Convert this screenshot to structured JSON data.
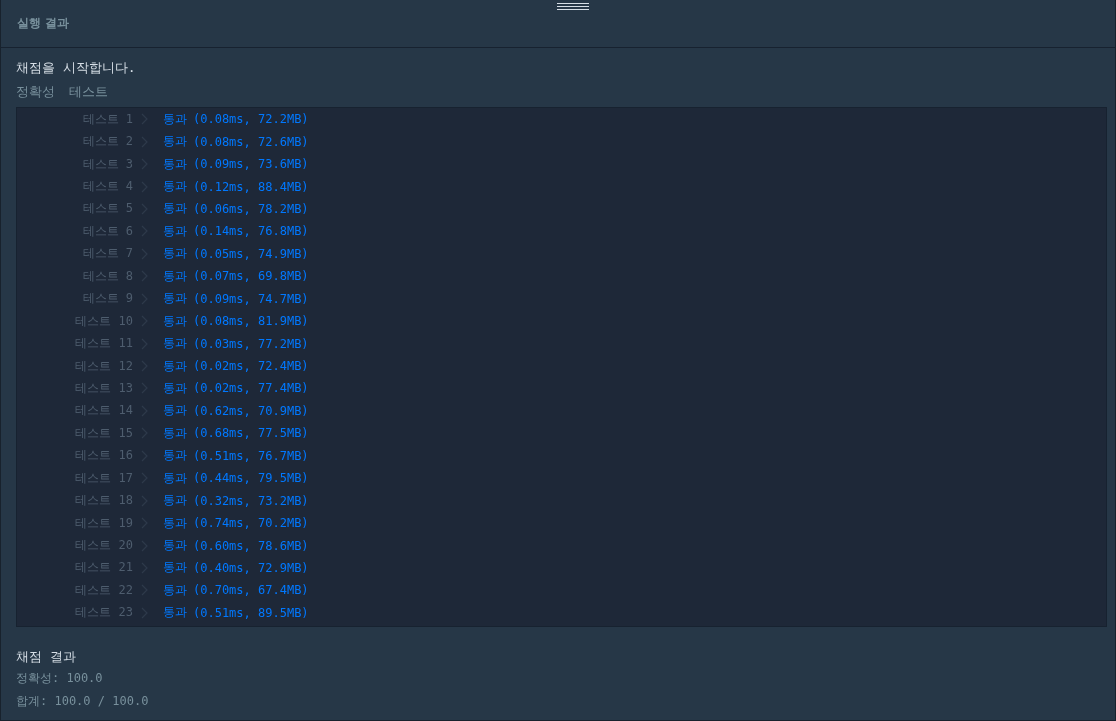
{
  "panel": {
    "title": "실행 결과"
  },
  "intro": "채점을 시작합니다.",
  "section": {
    "label": "정확성",
    "sublabel": "테스트"
  },
  "tests": [
    {
      "label": "테스트 1",
      "status": "통과",
      "detail": "(0.08ms, 72.2MB)"
    },
    {
      "label": "테스트 2",
      "status": "통과",
      "detail": "(0.08ms, 72.6MB)"
    },
    {
      "label": "테스트 3",
      "status": "통과",
      "detail": "(0.09ms, 73.6MB)"
    },
    {
      "label": "테스트 4",
      "status": "통과",
      "detail": "(0.12ms, 88.4MB)"
    },
    {
      "label": "테스트 5",
      "status": "통과",
      "detail": "(0.06ms, 78.2MB)"
    },
    {
      "label": "테스트 6",
      "status": "통과",
      "detail": "(0.14ms, 76.8MB)"
    },
    {
      "label": "테스트 7",
      "status": "통과",
      "detail": "(0.05ms, 74.9MB)"
    },
    {
      "label": "테스트 8",
      "status": "통과",
      "detail": "(0.07ms, 69.8MB)"
    },
    {
      "label": "테스트 9",
      "status": "통과",
      "detail": "(0.09ms, 74.7MB)"
    },
    {
      "label": "테스트 10",
      "status": "통과",
      "detail": "(0.08ms, 81.9MB)"
    },
    {
      "label": "테스트 11",
      "status": "통과",
      "detail": "(0.03ms, 77.2MB)"
    },
    {
      "label": "테스트 12",
      "status": "통과",
      "detail": "(0.02ms, 72.4MB)"
    },
    {
      "label": "테스트 13",
      "status": "통과",
      "detail": "(0.02ms, 77.4MB)"
    },
    {
      "label": "테스트 14",
      "status": "통과",
      "detail": "(0.62ms, 70.9MB)"
    },
    {
      "label": "테스트 15",
      "status": "통과",
      "detail": "(0.68ms, 77.5MB)"
    },
    {
      "label": "테스트 16",
      "status": "통과",
      "detail": "(0.51ms, 76.7MB)"
    },
    {
      "label": "테스트 17",
      "status": "통과",
      "detail": "(0.44ms, 79.5MB)"
    },
    {
      "label": "테스트 18",
      "status": "통과",
      "detail": "(0.32ms, 73.2MB)"
    },
    {
      "label": "테스트 19",
      "status": "통과",
      "detail": "(0.74ms, 70.2MB)"
    },
    {
      "label": "테스트 20",
      "status": "통과",
      "detail": "(0.60ms, 78.6MB)"
    },
    {
      "label": "테스트 21",
      "status": "통과",
      "detail": "(0.40ms, 72.9MB)"
    },
    {
      "label": "테스트 22",
      "status": "통과",
      "detail": "(0.70ms, 67.4MB)"
    },
    {
      "label": "테스트 23",
      "status": "통과",
      "detail": "(0.51ms, 89.5MB)"
    }
  ],
  "summary": {
    "title": "채점 결과",
    "lines": [
      "정확성: 100.0",
      "합계: 100.0 / 100.0"
    ]
  }
}
